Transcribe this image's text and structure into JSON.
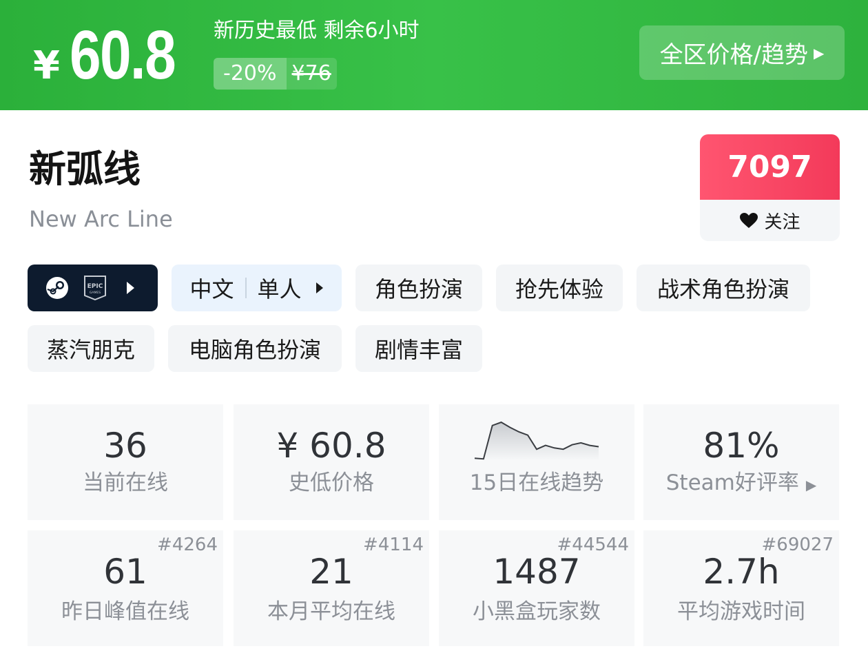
{
  "banner": {
    "currency": "¥",
    "price": "60.8",
    "deal_text": "新历史最低 剩余6小时",
    "discount": "-20%",
    "original_price": "¥76",
    "trend_button": "全区价格/趋势",
    "colors": {
      "background": "#33b943",
      "accent": "#ffffff"
    }
  },
  "game": {
    "title": "新弧线",
    "subtitle": "New Arc Line"
  },
  "follow": {
    "count": "7097",
    "label": "关注",
    "colors": {
      "count_bg": "#f8485f"
    }
  },
  "platform_tag": {
    "icons": [
      "steam-icon",
      "epic-games-icon",
      "chevron-right-icon"
    ]
  },
  "language_tag": {
    "language": "中文",
    "mode": "单人"
  },
  "tags": [
    "角色扮演",
    "抢先体验",
    "战术角色扮演",
    "蒸汽朋克",
    "电脑角色扮演",
    "剧情丰富"
  ],
  "stats": {
    "current_online": {
      "value": "36",
      "label": "当前在线"
    },
    "lowest_price": {
      "value": "¥ 60.8",
      "label": "史低价格"
    },
    "trend": {
      "label": "15日在线趋势",
      "chart_data": {
        "type": "area",
        "x": [
          1,
          2,
          3,
          4,
          5,
          6,
          7,
          8,
          9,
          10,
          11,
          12,
          13,
          14,
          15
        ],
        "values": [
          4,
          3,
          55,
          60,
          52,
          45,
          40,
          18,
          24,
          20,
          18,
          25,
          28,
          24,
          22
        ],
        "title": "",
        "xlabel": "",
        "ylabel": ""
      }
    },
    "steam_rating": {
      "value": "81%",
      "label": "Steam好评率"
    },
    "peak_yesterday": {
      "value": "61",
      "label": "昨日峰值在线",
      "rank": "#4264"
    },
    "monthly_avg": {
      "value": "21",
      "label": "本月平均在线",
      "rank": "#4114"
    },
    "heybox_players": {
      "value": "1487",
      "label": "小黑盒玩家数",
      "rank": "#44544"
    },
    "avg_playtime": {
      "value": "2.7h",
      "label": "平均游戏时间",
      "rank": "#69027"
    }
  }
}
